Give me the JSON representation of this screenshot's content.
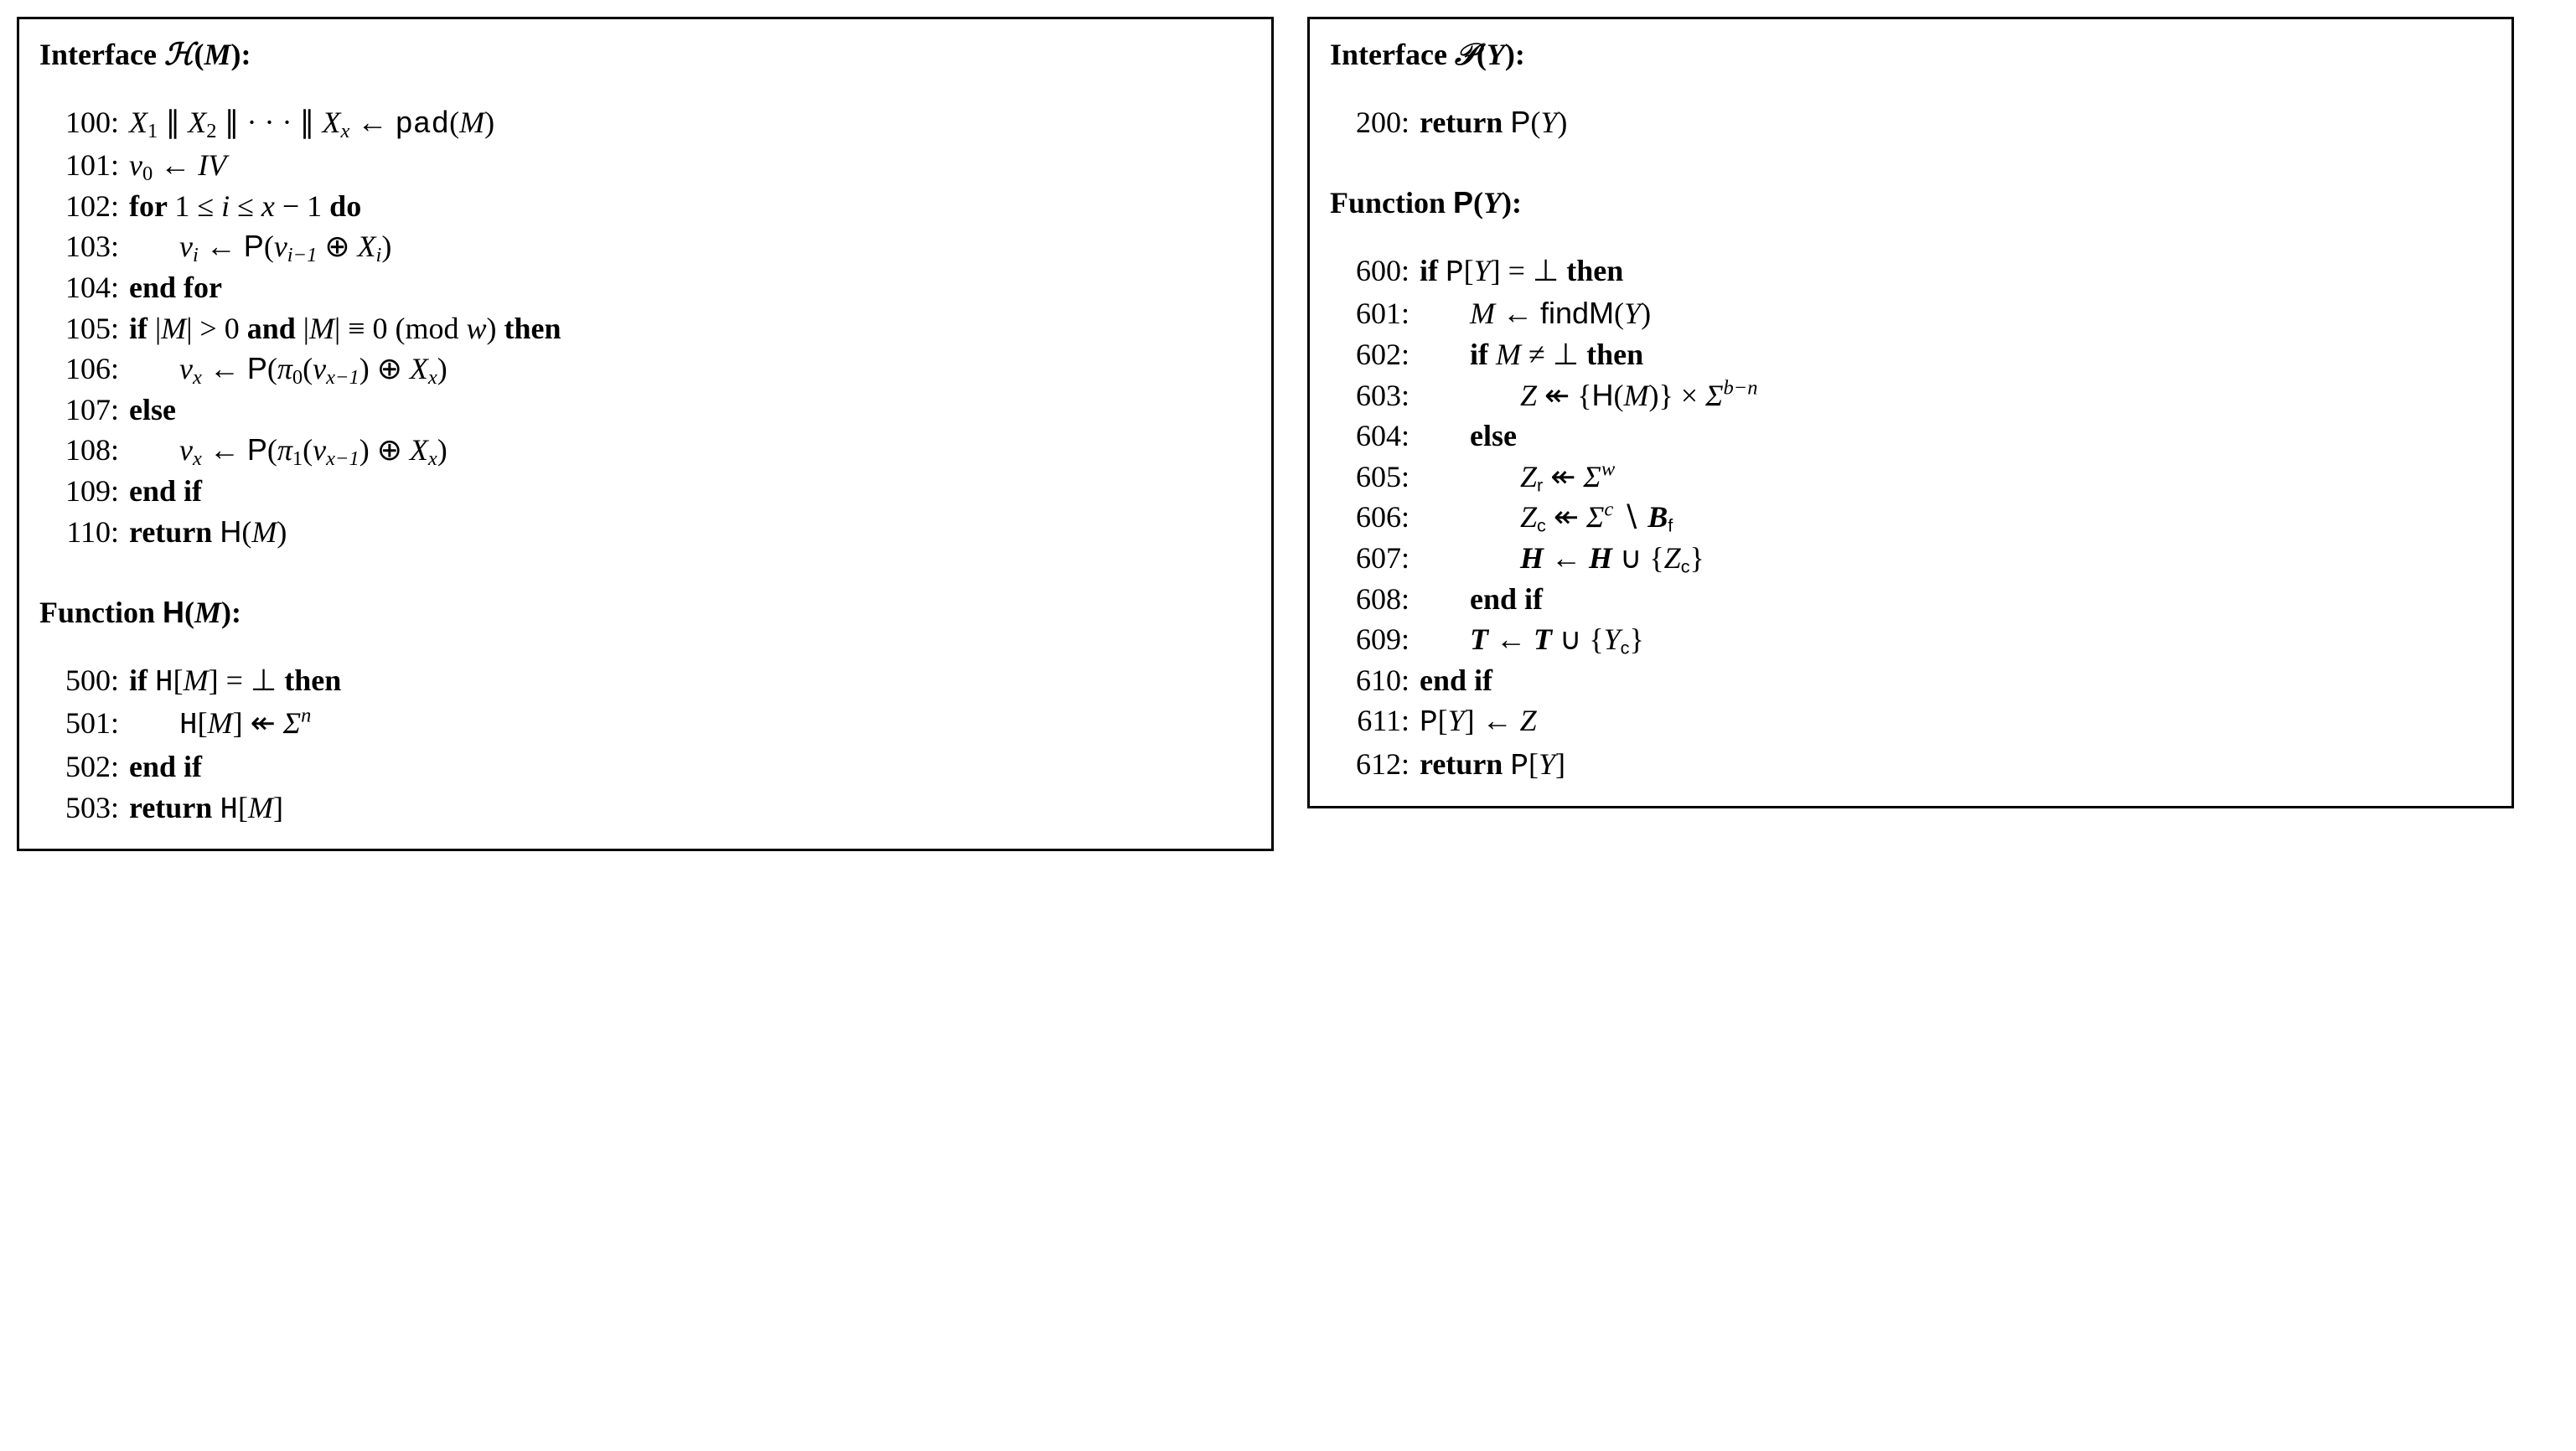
{
  "left": {
    "heading_pre": "Interface ",
    "heading_sym": "ℋ",
    "heading_arg": "(",
    "heading_var": "M",
    "heading_close": "):",
    "l100_num": "100:",
    "l100_X": "X",
    "l100_1": "1",
    "l100_bar": " ∥ ",
    "l100_2": "2",
    "l100_cdots": " ∥ · · · ∥ ",
    "l100_xsub": "x",
    "l100_arrow": " ← ",
    "l100_pad": "pad",
    "l100_open": "(",
    "l100_M": "M",
    "l100_close": ")",
    "l101_num": "101:",
    "l101_v": "v",
    "l101_0": "0",
    "l101_arrow": " ← ",
    "l101_IV": "IV",
    "l102_num": "102:",
    "l102_for": "for ",
    "l102_expr_1": "1 ≤ ",
    "l102_i": "i",
    "l102_le": " ≤ ",
    "l102_x": "x",
    "l102_minus1": " − 1 ",
    "l102_do": "do",
    "l103_num": "103:",
    "l103_v": "v",
    "l103_i": "i",
    "l103_arrow": " ← ",
    "l103_P": "P",
    "l103_open": "(",
    "l103_vi1v": "v",
    "l103_vi1sub": "i−1",
    "l103_oplus": " ⊕ ",
    "l103_X": "X",
    "l103_Xsub": "i",
    "l103_close": ")",
    "l104_num": "104:",
    "l104_endfor": "end for",
    "l105_num": "105:",
    "l105_if": "if ",
    "l105_absM_open": "|",
    "l105_M1": "M",
    "l105_absM_close": "| > 0 ",
    "l105_and": "and ",
    "l105_absM2_open": "|",
    "l105_M2": "M",
    "l105_absM2_close": "| ≡ 0  (mod ",
    "l105_w": "w",
    "l105_paren": ") ",
    "l105_then": "then",
    "l106_num": "106:",
    "l106_v": "v",
    "l106_x": "x",
    "l106_arrow": " ← ",
    "l106_P": "P",
    "l106_open": "(",
    "l106_pi": "π",
    "l106_pi0": "0",
    "l106_po": "(",
    "l106_vv": "v",
    "l106_vx1": "x−1",
    "l106_pc": ") ⊕ ",
    "l106_X": "X",
    "l106_Xx": "x",
    "l106_close": ")",
    "l107_num": "107:",
    "l107_else": "else",
    "l108_num": "108:",
    "l108_v": "v",
    "l108_x": "x",
    "l108_arrow": " ← ",
    "l108_P": "P",
    "l108_open": "(",
    "l108_pi": "π",
    "l108_pi1": "1",
    "l108_po": "(",
    "l108_vv": "v",
    "l108_vx1": "x−1",
    "l108_pc": ") ⊕ ",
    "l108_X": "X",
    "l108_Xx": "x",
    "l108_close": ")",
    "l109_num": "109:",
    "l109_endif": "end if",
    "l110_num": "110:",
    "l110_return": "return ",
    "l110_H": "H",
    "l110_open": "(",
    "l110_M": "M",
    "l110_close": ")",
    "funcH_pre": "Function ",
    "funcH_H": "H",
    "funcH_open": "(",
    "funcH_M": "M",
    "funcH_close": "):",
    "l500_num": "500:",
    "l500_if": "if ",
    "l500_H": "H",
    "l500_open": "[",
    "l500_M": "M",
    "l500_close": "] = ⊥ ",
    "l500_then": "then",
    "l501_num": "501:",
    "l501_H": "H",
    "l501_open": "[",
    "l501_M": "M",
    "l501_close": "] ↞ ",
    "l501_Sigma": "Σ",
    "l501_n": "n",
    "l502_num": "502:",
    "l502_endif": "end if",
    "l503_num": "503:",
    "l503_return": "return ",
    "l503_H": "H",
    "l503_open": "[",
    "l503_M": "M",
    "l503_close": "]"
  },
  "right": {
    "heading_pre": "Interface ",
    "heading_sym": "𝒫",
    "heading_open": "(",
    "heading_Y": "Y",
    "heading_close": "):",
    "l200_num": "200:",
    "l200_return": "return ",
    "l200_P": "P",
    "l200_open": "(",
    "l200_Y": "Y",
    "l200_close": ")",
    "funcP_pre": "Function ",
    "funcP_P": "P",
    "funcP_open": "(",
    "funcP_Y": "Y",
    "funcP_close": "):",
    "l600_num": "600:",
    "l600_if": "if ",
    "l600_P": "P",
    "l600_open": "[",
    "l600_Y": "Y",
    "l600_close": "] = ⊥ ",
    "l600_then": "then",
    "l601_num": "601:",
    "l601_M": "M",
    "l601_arrow": " ← ",
    "l601_findM": "findM",
    "l601_open": "(",
    "l601_Y": "Y",
    "l601_close": ")",
    "l602_num": "602:",
    "l602_if": "if ",
    "l602_M": "M",
    "l602_neqbot": " ≠ ⊥ ",
    "l602_then": "then",
    "l603_num": "603:",
    "l603_Z": "Z",
    "l603_arrow": " ↞ {",
    "l603_H": "H",
    "l603_open": "(",
    "l603_M": "M",
    "l603_close": ")} × ",
    "l603_Sigma": "Σ",
    "l603_sup": "b−n",
    "l604_num": "604:",
    "l604_else": "else",
    "l605_num": "605:",
    "l605_Z": "Z",
    "l605_r": "r",
    "l605_arrow": " ↞ ",
    "l605_Sigma": "Σ",
    "l605_w": "w",
    "l606_num": "606:",
    "l606_Z": "Z",
    "l606_c": "c",
    "l606_arrow": " ↞ ",
    "l606_Sigma": "Σ",
    "l606_csup": "c",
    "l606_setminus": " ∖ ",
    "l606_B": "B",
    "l606_f": "f",
    "l607_num": "607:",
    "l607_H": "H",
    "l607_arrow": " ← ",
    "l607_H2": "H",
    "l607_cup": " ∪ {",
    "l607_Z": "Z",
    "l607_c": "c",
    "l607_close": "}",
    "l608_num": "608:",
    "l608_endif": "end if",
    "l609_num": "609:",
    "l609_T": "T",
    "l609_arrow": " ← ",
    "l609_T2": "T",
    "l609_cup": " ∪ {",
    "l609_Y": "Y",
    "l609_c": "c",
    "l609_close": "}",
    "l610_num": "610:",
    "l610_endif": "end if",
    "l611_num": "611:",
    "l611_P": "P",
    "l611_open": "[",
    "l611_Y": "Y",
    "l611_close": "] ← ",
    "l611_Z": "Z",
    "l612_num": "612:",
    "l612_return": "return ",
    "l612_P": "P",
    "l612_open": "[",
    "l612_Y": "Y",
    "l612_close": "]"
  }
}
